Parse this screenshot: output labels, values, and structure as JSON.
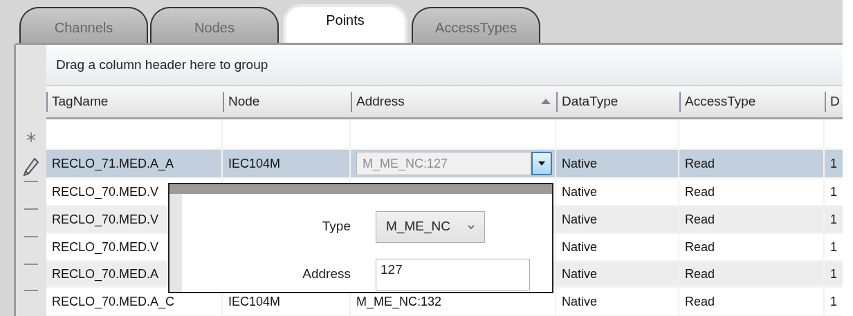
{
  "tabs": [
    {
      "label": "Channels",
      "selected": false
    },
    {
      "label": "Nodes",
      "selected": false
    },
    {
      "label": "Points",
      "selected": true
    },
    {
      "label": "AccessTypes",
      "selected": false
    }
  ],
  "grid": {
    "group_panel": "Drag a column header here to group",
    "columns": [
      {
        "label": "TagName",
        "sorted": false
      },
      {
        "label": "Node",
        "sorted": false
      },
      {
        "label": "Address",
        "sorted": true
      },
      {
        "label": "DataType",
        "sorted": false
      },
      {
        "label": "AccessType",
        "sorted": false
      },
      {
        "label": "D"
      }
    ],
    "rows": [
      {
        "kind": "new",
        "selected": false,
        "cells": {}
      },
      {
        "kind": "editing",
        "selected": true,
        "cells": {
          "tag_name": "RECLO_71.MED.A_A",
          "node": "IEC104M",
          "address_editor": "M_ME_NC:127",
          "data_type": "Native",
          "access_type": "Read",
          "column_6": "1"
        }
      },
      {
        "kind": "data",
        "selected": false,
        "cells": {
          "tag_name": "RECLO_70.MED.V",
          "data_type": "Native",
          "access_type": "Read",
          "column_6": "1"
        }
      },
      {
        "kind": "data",
        "selected": false,
        "cells": {
          "tag_name": "RECLO_70.MED.V",
          "data_type": "Native",
          "access_type": "Read",
          "column_6": "1"
        }
      },
      {
        "kind": "data",
        "selected": false,
        "cells": {
          "tag_name": "RECLO_70.MED.V",
          "data_type": "Native",
          "access_type": "Read",
          "column_6": "1"
        }
      },
      {
        "kind": "data",
        "selected": false,
        "cells": {
          "tag_name": "RECLO_70.MED.A",
          "data_type": "Native",
          "access_type": "Read",
          "column_6": "1"
        }
      },
      {
        "kind": "data",
        "selected": false,
        "cells": {
          "tag_name": "RECLO_70.MED.A_C",
          "node": "IEC104M",
          "address": "M_ME_NC:132",
          "data_type": "Native",
          "access_type": "Read",
          "column_6": "1"
        }
      }
    ]
  },
  "address_popup": {
    "type_label": "Type",
    "type_value": "M_ME_NC",
    "address_label": "Address",
    "address_value": "127"
  }
}
